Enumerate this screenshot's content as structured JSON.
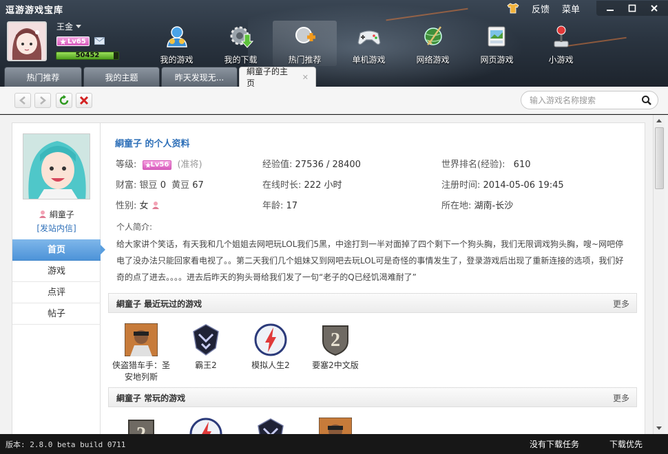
{
  "app": {
    "title": "逗游游戏宝库"
  },
  "top_right": {
    "feedback": "反馈",
    "menu": "菜单"
  },
  "user": {
    "name": "王金",
    "level": "Lv65",
    "exp_value": "50452",
    "exp_fraction": 0.92
  },
  "nav": [
    {
      "label": "我的游戏",
      "icon": "my-games-icon"
    },
    {
      "label": "我的下载",
      "icon": "download-gear-icon"
    },
    {
      "label": "热门推荐",
      "icon": "hot-recommend-icon"
    },
    {
      "label": "单机游戏",
      "icon": "gamepad-icon"
    },
    {
      "label": "网络游戏",
      "icon": "globe-sword-icon"
    },
    {
      "label": "网页游戏",
      "icon": "web-game-icon"
    },
    {
      "label": "小游戏",
      "icon": "joystick-icon"
    }
  ],
  "tabs": [
    {
      "label": "热门推荐"
    },
    {
      "label": "我的主题"
    },
    {
      "label": "昨天发现无..."
    },
    {
      "label": "絧童子的主页"
    }
  ],
  "search": {
    "placeholder": "输入游戏名称搜索"
  },
  "sidebar": {
    "name": "絧童子",
    "send_message": "[发站内信]",
    "menu": [
      "首页",
      "游戏",
      "点评",
      "帖子"
    ]
  },
  "profile": {
    "title": "絧童子 的个人资料",
    "level_label": "等级:",
    "level_badge": "Lv56",
    "level_rank": "(准将)",
    "exp_label": "经验值:",
    "exp_value": "27536 / 28400",
    "world_rank_label": "世界排名(经验):",
    "world_rank": "610",
    "wealth_label": "财富:",
    "silver_label": "银豆",
    "silver_value": "0",
    "gold_label": "黄豆",
    "gold_value": "67",
    "online_label": "在线时长:",
    "online_value": "222 小时",
    "reg_label": "注册时间:",
    "reg_value": "2014-05-06 19:45",
    "gender_label": "性别:",
    "gender_value": "女",
    "age_label": "年龄:",
    "age_value": "17",
    "location_label": "所在地:",
    "location_value": "湖南-长沙",
    "bio_label": "个人简介:",
    "bio": "给大家讲个笑话，有天我和几个姐姐去网吧玩LOL我们5黑，中途打到一半对面掉了四个剩下一个狗头胸，我们无限调戏狗头胸，嗖~网吧停电了没办法只能回家看电视了。。第二天我们几个姐妹又到网吧去玩LOL可是奇怪的事情发生了，登录游戏后出现了重新连接的选项，我们好奇的点了进去。。。。进去后昨天的狗头哥给我们发了一句“老子的Q已经饥渴难耐了”"
  },
  "recent": {
    "title": "絧童子 最近玩过的游戏",
    "more": "更多",
    "games": [
      {
        "name": "侠盗猎车手：圣安地列斯",
        "icon": "gta-icon"
      },
      {
        "name": "霸王2",
        "icon": "overlord-icon"
      },
      {
        "name": "模拟人生2",
        "icon": "sims-icon"
      },
      {
        "name": "要塞2中文版",
        "icon": "stronghold-icon"
      }
    ]
  },
  "frequent": {
    "title": "絧童子 常玩的游戏",
    "more": "更多"
  },
  "footer": {
    "version": "版本: 2.8.0 beta build 0711",
    "no_tasks": "没有下载任务",
    "priority": "下载优先"
  }
}
